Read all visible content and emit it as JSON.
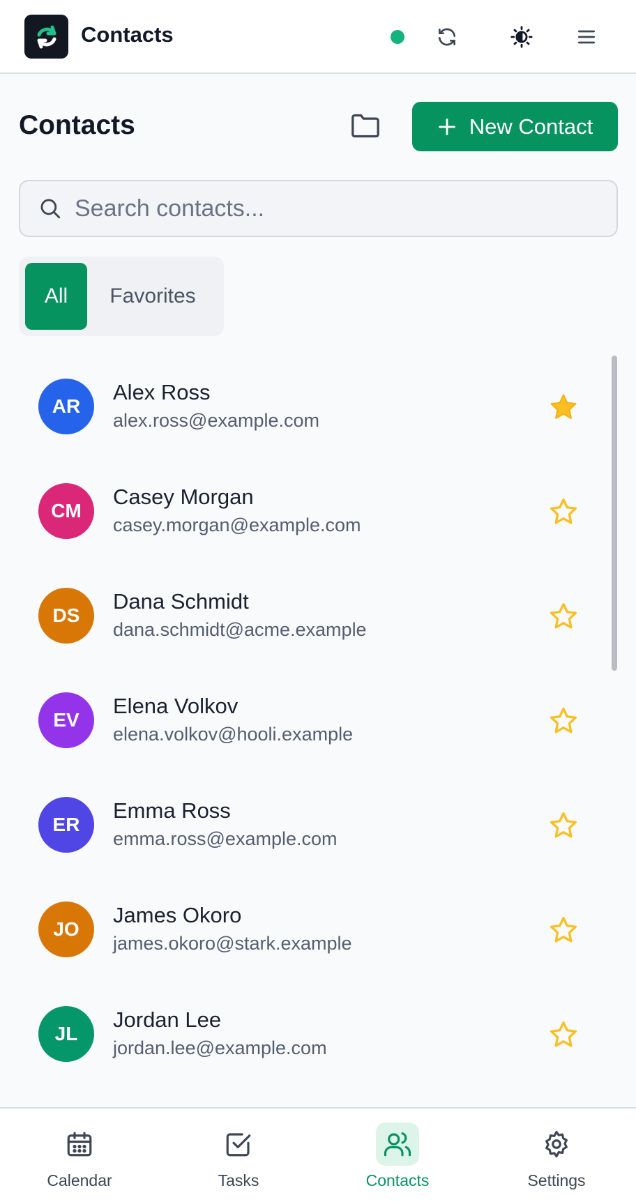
{
  "header": {
    "title": "Contacts",
    "icons": [
      "app-logo",
      "status-dot",
      "sync-icon",
      "theme-icon",
      "menu-icon"
    ],
    "status_color": "#14b37b"
  },
  "page": {
    "title": "Contacts",
    "new_button_label": "New Contact",
    "accent": "#07935f"
  },
  "search": {
    "placeholder": "Search contacts..."
  },
  "filter_tabs": {
    "all": "All",
    "favorites": "Favorites",
    "selected": "All"
  },
  "contacts": [
    {
      "initials": "AR",
      "name": "Alex Ross",
      "email": "alex.ross@example.com",
      "color": "#2563eb",
      "favorite": true
    },
    {
      "initials": "CM",
      "name": "Casey Morgan",
      "email": "casey.morgan@example.com",
      "color": "#db2777",
      "favorite": false
    },
    {
      "initials": "DS",
      "name": "Dana Schmidt",
      "email": "dana.schmidt@acme.example",
      "color": "#d97706",
      "favorite": false
    },
    {
      "initials": "EV",
      "name": "Elena Volkov",
      "email": "elena.volkov@hooli.example",
      "color": "#9333ea",
      "favorite": false
    },
    {
      "initials": "ER",
      "name": "Emma Ross",
      "email": "emma.ross@example.com",
      "color": "#4f46e5",
      "favorite": false
    },
    {
      "initials": "JO",
      "name": "James Okoro",
      "email": "james.okoro@stark.example",
      "color": "#d97706",
      "favorite": false
    },
    {
      "initials": "JL",
      "name": "Jordan Lee",
      "email": "jordan.lee@example.com",
      "color": "#059669",
      "favorite": false
    }
  ],
  "bottom_nav": [
    {
      "label": "Calendar",
      "icon": "calendar-icon",
      "active": false
    },
    {
      "label": "Tasks",
      "icon": "tasks-icon",
      "active": false
    },
    {
      "label": "Contacts",
      "icon": "contacts-icon",
      "active": true
    },
    {
      "label": "Settings",
      "icon": "settings-icon",
      "active": false
    }
  ]
}
